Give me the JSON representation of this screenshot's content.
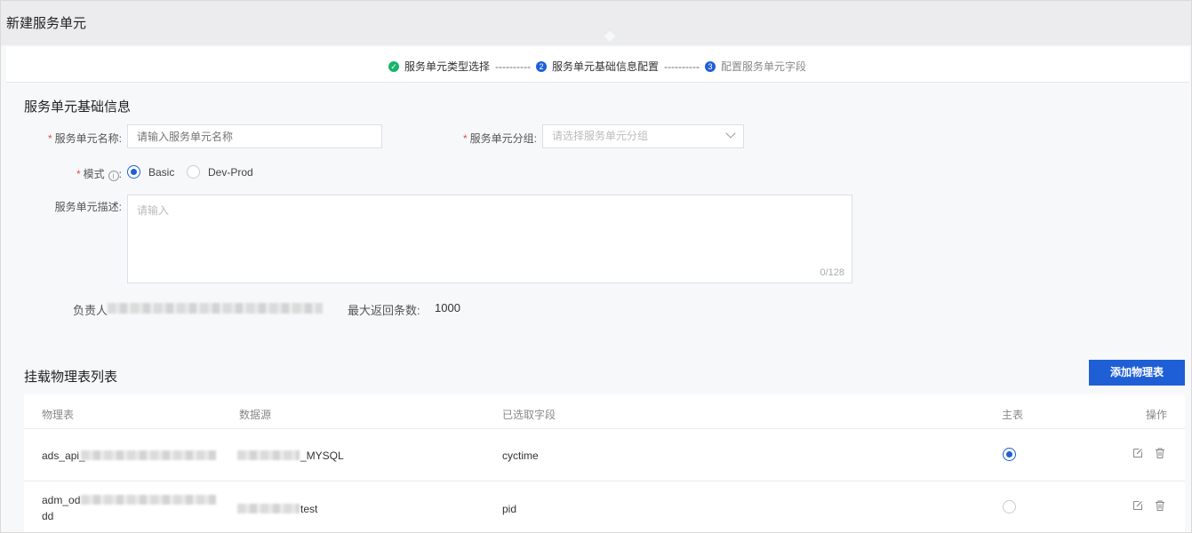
{
  "page": {
    "title": "新建服务单元"
  },
  "steps": [
    {
      "label": "服务单元类型选择",
      "status": "done",
      "icon": "check-circle-icon"
    },
    {
      "num": "2",
      "label": "服务单元基础信息配置",
      "status": "active"
    },
    {
      "num": "3",
      "label": "配置服务单元字段",
      "status": "future"
    }
  ],
  "step_separator": "----------",
  "basic_info": {
    "title": "服务单元基础信息",
    "required_mark": "*",
    "name": {
      "label": "服务单元名称:",
      "placeholder": "请输入服务单元名称",
      "value": ""
    },
    "group": {
      "label": "服务单元分组:",
      "placeholder": "请选择服务单元分组",
      "value": ""
    },
    "mode": {
      "label": "模式",
      "colon": ":",
      "info_glyph": "i",
      "options": [
        {
          "label": "Basic",
          "checked": true
        },
        {
          "label": "Dev-Prod",
          "checked": false
        }
      ]
    },
    "description": {
      "label": "服务单元描述:",
      "placeholder": "请输入",
      "counter": "0/128"
    },
    "owner_label": "负责人",
    "max_rows_label": "最大返回条数:",
    "max_rows_value": "1000"
  },
  "mounted_tables": {
    "title": "挂载物理表列表",
    "add_button": "添加物理表",
    "columns": [
      "物理表",
      "数据源",
      "已选取字段",
      "主表",
      "操作"
    ],
    "rows": [
      {
        "table_prefix": "ads_api_",
        "table_suffix": "",
        "source_suffix": "_MYSQL",
        "fields": "cyctime",
        "is_main": true
      },
      {
        "table_prefix": "adm_od",
        "table_suffix": "dd",
        "source_suffix": "test",
        "fields": "pid",
        "is_main": false
      }
    ]
  },
  "colors": {
    "primary": "#1e5fd6",
    "success": "#19b36b",
    "required": "#e34d4d"
  }
}
